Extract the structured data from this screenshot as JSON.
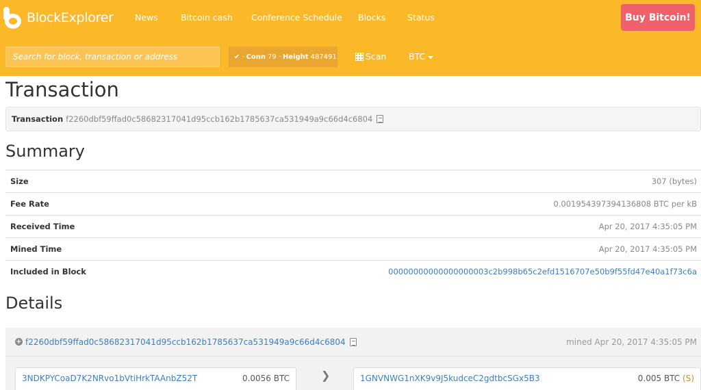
{
  "brand": {
    "name": "BlockExplorer"
  },
  "nav": [
    {
      "label": "News"
    },
    {
      "label": "Bitcoin cash"
    },
    {
      "label": "Conference Schedule"
    },
    {
      "label": "Blocks"
    },
    {
      "label": "Status"
    }
  ],
  "buy_button": {
    "label": "Buy Bitcoin!"
  },
  "search": {
    "placeholder": "Search for block, transaction or address"
  },
  "status": {
    "sep": "·",
    "conn_label": "Conn",
    "conn_value": "79",
    "height_label": "Height",
    "height_value": "487491"
  },
  "scan": {
    "label": "Scan"
  },
  "currency": {
    "selected": "BTC"
  },
  "page_title": "Transaction",
  "transaction": {
    "label": "Transaction",
    "hash": "f2260dbf59ffad0c58682317041d95ccb162b1785637ca531949a9c66d4c6804"
  },
  "summary": {
    "title": "Summary",
    "rows": [
      {
        "label": "Size",
        "value": "307 (bytes)"
      },
      {
        "label": "Fee Rate",
        "value": "0.001954397394136808 BTC per kB"
      },
      {
        "label": "Received Time",
        "value": "Apr 20, 2017 4:35:05 PM"
      },
      {
        "label": "Mined Time",
        "value": "Apr 20, 2017 4:35:05 PM"
      },
      {
        "label": "Included in Block",
        "value": "00000000000000000003c2b998b65c2efd1516707e50b9f55fd47e40a1f73c6a"
      }
    ]
  },
  "details": {
    "title": "Details",
    "tx_hash": "f2260dbf59ffad0c58682317041d95ccb162b1785637ca531949a9c66d4c6804",
    "mined": "mined Apr 20, 2017 4:35:05 PM",
    "input": {
      "address": "3NDKPYCoaD7K2NRvo1bVtiHrkTAAnbZ52T",
      "amount": "0.0056 BTC"
    },
    "output": {
      "address": "1GNVNWG1nXK9v9J5kudceC2gdtbcSGx5B3",
      "amount": "0.005 BTC",
      "flag": "(S)"
    }
  },
  "colors": {
    "topbar": "#fbb829",
    "buy_button": "#f0606a",
    "link": "#3a80c0"
  }
}
